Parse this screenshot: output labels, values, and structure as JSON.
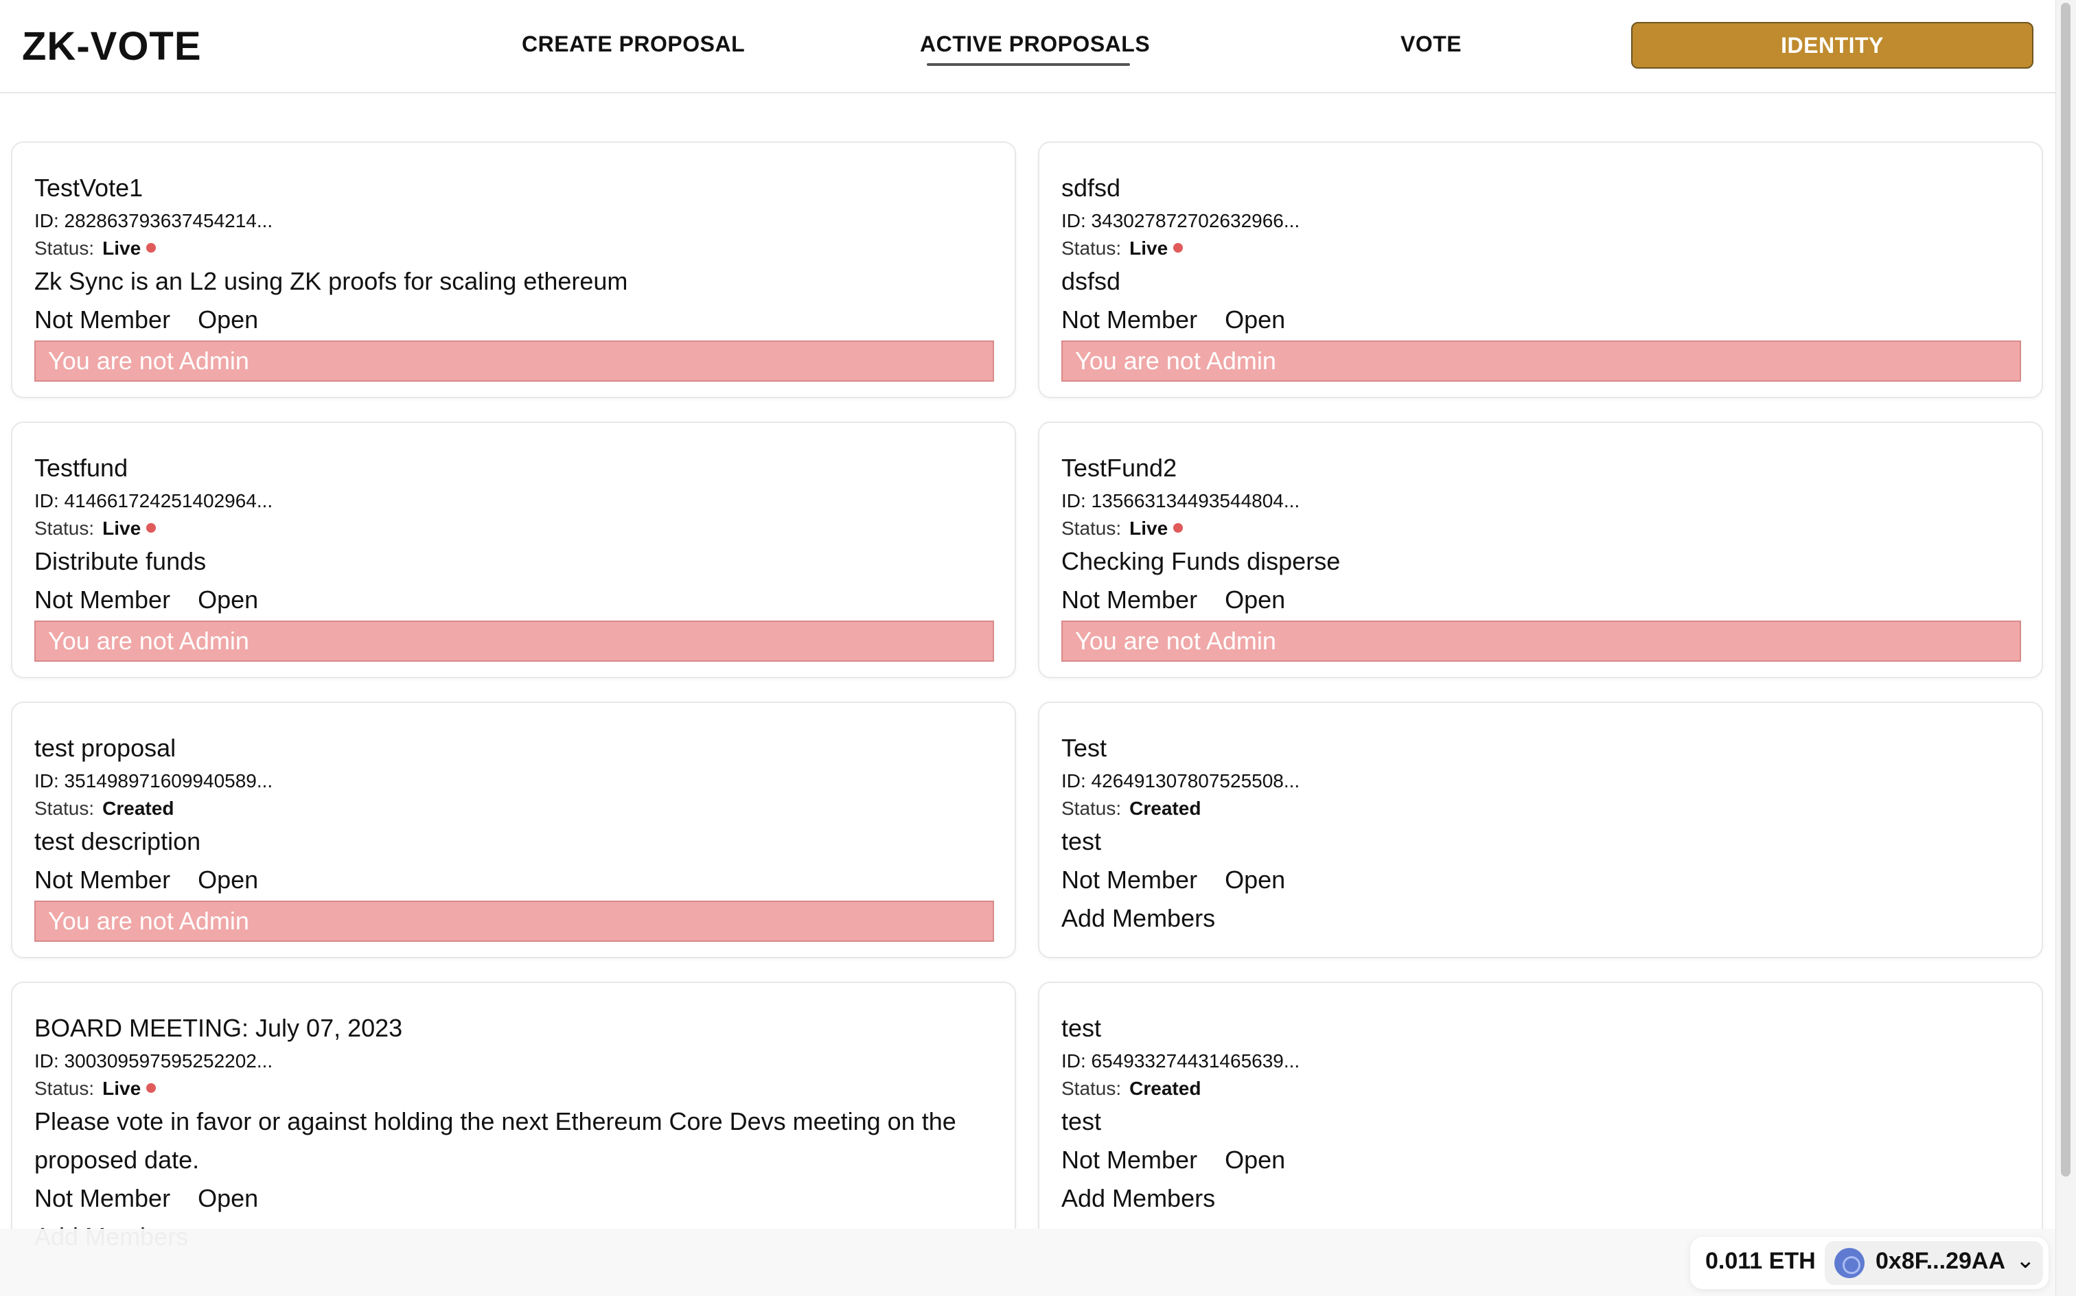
{
  "header": {
    "logo": "ZK-VOTE",
    "nav": {
      "create": "CREATE PROPOSAL",
      "active": "ACTIVE PROPOSALS",
      "vote": "VOTE",
      "identity": "IDENTITY"
    },
    "accent_color": "#bf8b2e"
  },
  "cards": [
    {
      "title": "TestVote1",
      "id": "ID: 282863793637454214...",
      "status_label": "Status:",
      "status": "Live",
      "desc": "Zk Sync is an L2 using ZK proofs for scaling ethereum",
      "member": "Not Member",
      "open": "Open",
      "footer": "You are not Admin"
    },
    {
      "title": "sdfsd",
      "id": "ID: 343027872702632966...",
      "status_label": "Status:",
      "status": "Live",
      "desc": "dsfsd",
      "member": "Not Member",
      "open": "Open",
      "footer": "You are not Admin"
    },
    {
      "title": "Testfund",
      "id": "ID: 414661724251402964...",
      "status_label": "Status:",
      "status": "Live",
      "desc": "Distribute funds",
      "member": "Not Member",
      "open": "Open",
      "footer": "You are not Admin"
    },
    {
      "title": "TestFund2",
      "id": "ID: 135663134493544804...",
      "status_label": "Status:",
      "status": "Live",
      "desc": "Checking Funds disperse",
      "member": "Not Member",
      "open": "Open",
      "footer": "You are not Admin"
    },
    {
      "title": "test proposal",
      "id": "ID: 351498971609940589...",
      "status_label": "Status:",
      "status": "Created",
      "desc": "test description",
      "member": "Not Member",
      "open": "Open",
      "footer": "You are not Admin"
    },
    {
      "title": "Test",
      "id": "ID: 426491307807525508...",
      "status_label": "Status:",
      "status": "Created",
      "desc": "test",
      "member": "Not Member",
      "open": "Open",
      "footer": "Add Members"
    },
    {
      "title": "BOARD MEETING: July 07, 2023",
      "id": "ID: 300309597595252202...",
      "status_label": "Status:",
      "status": "Live",
      "desc": "Please vote in favor or against holding the next Ethereum Core Devs meeting on the proposed date.",
      "member": "Not Member",
      "open": "Open",
      "footer": "Add Members"
    },
    {
      "title": "test",
      "id": "ID: 654933274431465639...",
      "status_label": "Status:",
      "status": "Created",
      "desc": "test",
      "member": "Not Member",
      "open": "Open",
      "footer": "Add Members"
    }
  ],
  "wallet": {
    "balance": "0.011 ETH",
    "address": "0x8F...29AA",
    "chevron_icon": "chevron-down-icon"
  }
}
